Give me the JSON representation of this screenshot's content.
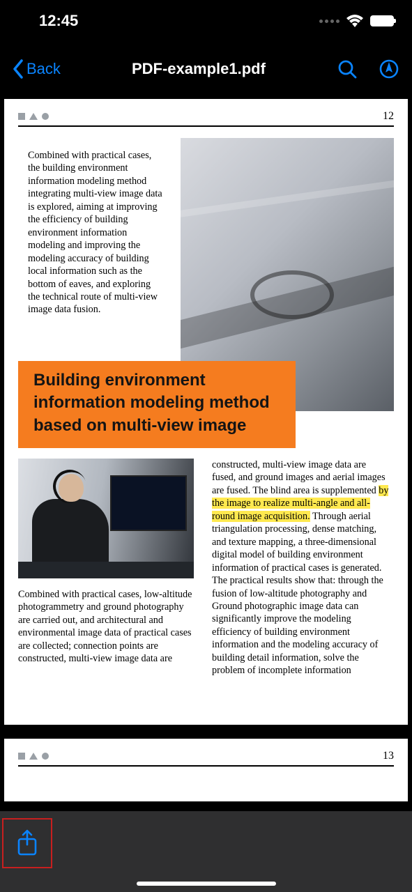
{
  "status": {
    "time": "12:45"
  },
  "nav": {
    "back": "Back",
    "title": "PDF-example1.pdf"
  },
  "page1": {
    "number": "12",
    "para1": "Combined with practical cases, the building environment information modeling method integrating multi-view image data is explored, aiming at improving the efficiency of building environment information modeling and improving the modeling accuracy of building local information such as the bottom of eaves, and exploring the technical route of multi-view image data fusion.",
    "title": "Building environment information modeling method based on multi-view image",
    "para_left": "Combined with practical cases, low-altitude photogrammetry and ground photography are carried out, and architectural and environmental image data of practical cases are collected; connection points are constructed, multi-view image data are",
    "para_right_a": "constructed, multi-view image data are fused, and ground images and aerial images are fused. The blind area is supplemented ",
    "para_right_hl": "by the image to realize multi-angle and all-round image acquisition.",
    "para_right_b": " Through aerial triangulation processing, dense matching, and texture mapping, a three-dimensional digital model of building environment information of practical cases is generated. The practical results show that: through the fusion of low-altitude photography and Ground photographic image data can significantly improve the modeling efficiency of building environment information and the modeling accuracy of building detail information, solve the problem of incomplete information"
  },
  "page2": {
    "number": "13"
  }
}
